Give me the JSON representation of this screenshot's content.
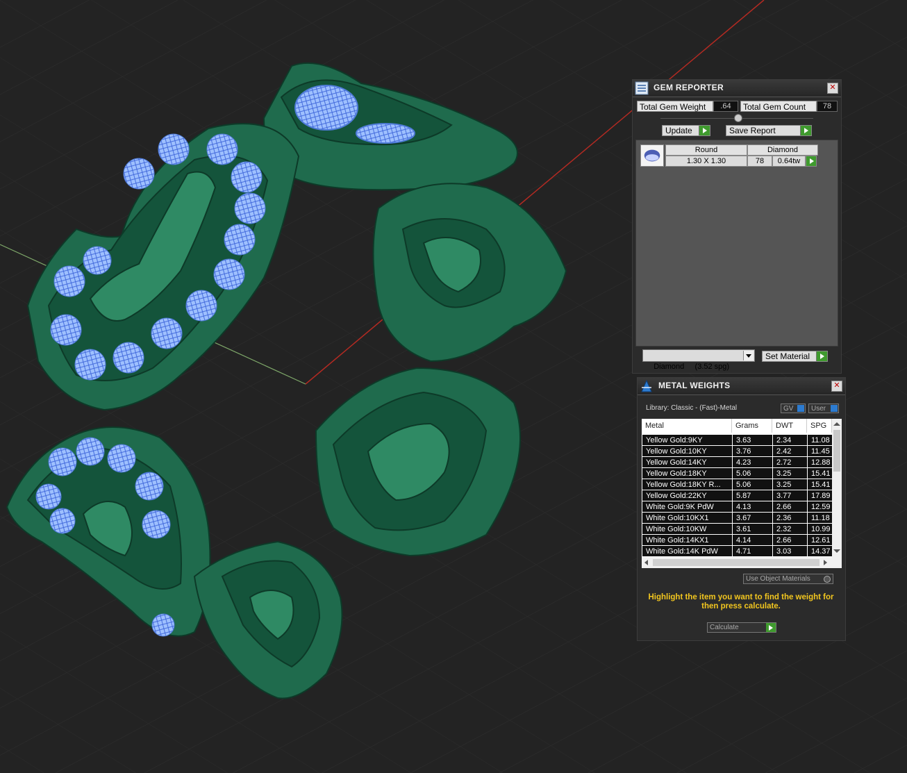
{
  "gem_reporter": {
    "title": "GEM REPORTER",
    "total_weight_label": "Total Gem Weight",
    "total_weight_value": ".64",
    "total_count_label": "Total Gem Count",
    "total_count_value": "78",
    "update_label": "Update",
    "save_report_label": "Save Report",
    "gem_row": {
      "shape": "Round",
      "material": "Diamond",
      "size": "1.30 X 1.30",
      "count": "78",
      "weight": "0.64tw"
    },
    "material_select": "Diamond     (3.52 spg)",
    "set_material_label": "Set Material"
  },
  "metal_weights": {
    "title": "METAL WEIGHTS",
    "library": "Library: Classic - (Fast)-Metal",
    "gv_label": "GV",
    "user_label": "User",
    "columns": [
      "Metal",
      "Grams",
      "DWT",
      "SPG"
    ],
    "rows": [
      [
        "Yellow Gold:9KY",
        "3.63",
        "2.34",
        "11.08"
      ],
      [
        "Yellow Gold:10KY",
        "3.76",
        "2.42",
        "11.45"
      ],
      [
        "Yellow Gold:14KY",
        "4.23",
        "2.72",
        "12.88"
      ],
      [
        "Yellow Gold:18KY",
        "5.06",
        "3.25",
        "15.41"
      ],
      [
        "Yellow Gold:18KY R...",
        "5.06",
        "3.25",
        "15.41"
      ],
      [
        "Yellow Gold:22KY",
        "5.87",
        "3.77",
        "17.89"
      ],
      [
        "White Gold:9K PdW",
        "4.13",
        "2.66",
        "12.59"
      ],
      [
        "White Gold:10KX1",
        "3.67",
        "2.36",
        "11.18"
      ],
      [
        "White Gold:10KW",
        "3.61",
        "2.32",
        "10.99"
      ],
      [
        "White Gold:14KX1",
        "4.14",
        "2.66",
        "12.61"
      ],
      [
        "White Gold:14K PdW",
        "4.71",
        "3.03",
        "14.37"
      ]
    ],
    "use_object_materials": "Use Object Materials",
    "hint": "Highlight the item you want to find the weight for then press calculate.",
    "calculate_label": "Calculate"
  },
  "colors": {
    "viewport_bg": "#232323",
    "grid": "#2f2f2f",
    "axis_x": "#b42a22",
    "axis_y": "#7fa96a",
    "metal": "#1f6b4d",
    "metal_light": "#2f8a64",
    "gem": "#8fb4ff"
  }
}
